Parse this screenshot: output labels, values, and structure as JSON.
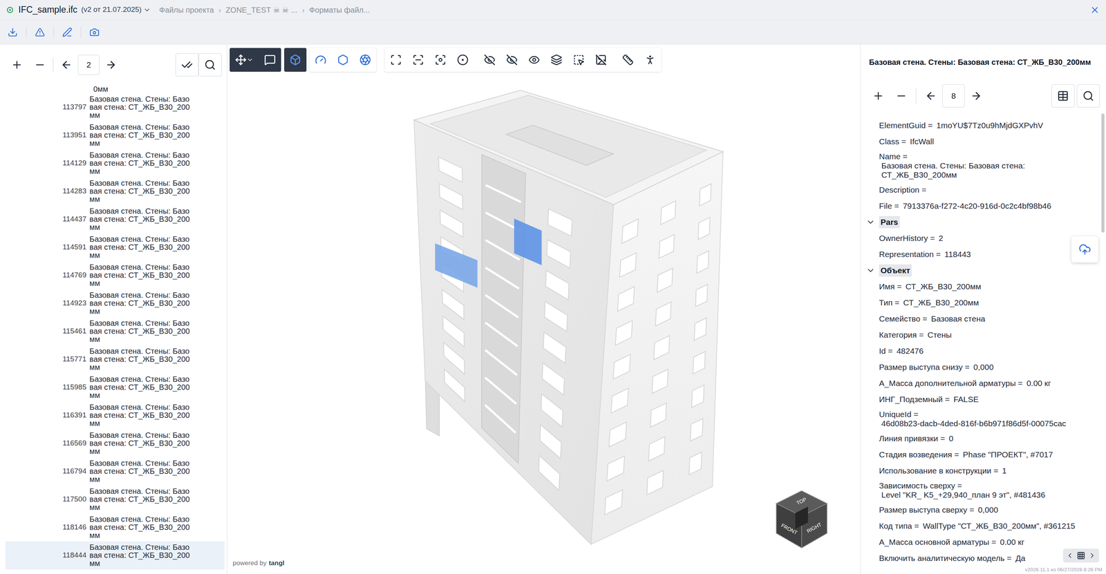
{
  "header": {
    "file": "IFC_sample.ifc",
    "version": "(v2 от 21.07.2025)",
    "breadcrumb": [
      "Файлы проекта",
      "ZONE_TEST ☠ ☠ ...",
      "Форматы файл..."
    ],
    "separator": "›"
  },
  "left_panel": {
    "page": "2",
    "clipped_top": "0мм",
    "items": [
      {
        "id": "113797",
        "name": "Базовая стена. Стены: Базовая стена: СТ_ЖБ_В30_200мм",
        "selected": false
      },
      {
        "id": "113951",
        "name": "Базовая стена. Стены: Базовая стена: СТ_ЖБ_В30_200мм",
        "selected": false
      },
      {
        "id": "114129",
        "name": "Базовая стена. Стены: Базовая стена: СТ_ЖБ_В30_200мм",
        "selected": false
      },
      {
        "id": "114283",
        "name": "Базовая стена. Стены: Базовая стена: СТ_ЖБ_В30_200мм",
        "selected": false
      },
      {
        "id": "114437",
        "name": "Базовая стена. Стены: Базовая стена: СТ_ЖБ_В30_200мм",
        "selected": false
      },
      {
        "id": "114591",
        "name": "Базовая стена. Стены: Базовая стена: СТ_ЖБ_В30_200мм",
        "selected": false
      },
      {
        "id": "114769",
        "name": "Базовая стена. Стены: Базовая стена: СТ_ЖБ_В30_200мм",
        "selected": false
      },
      {
        "id": "114923",
        "name": "Базовая стена. Стены: Базовая стена: СТ_ЖБ_В30_200мм",
        "selected": false
      },
      {
        "id": "115461",
        "name": "Базовая стена. Стены: Базовая стена: СТ_ЖБ_В30_200мм",
        "selected": false
      },
      {
        "id": "115771",
        "name": "Базовая стена. Стены: Базовая стена: СТ_ЖБ_В30_200мм",
        "selected": false
      },
      {
        "id": "115985",
        "name": "Базовая стена. Стены: Базовая стена: СТ_ЖБ_В30_200мм",
        "selected": false
      },
      {
        "id": "116391",
        "name": "Базовая стена. Стены: Базовая стена: СТ_ЖБ_В30_200мм",
        "selected": false
      },
      {
        "id": "116569",
        "name": "Базовая стена. Стены: Базовая стена: СТ_ЖБ_В30_200мм",
        "selected": false
      },
      {
        "id": "116794",
        "name": "Базовая стена. Стены: Базовая стена: СТ_ЖБ_В30_200мм",
        "selected": false
      },
      {
        "id": "117500",
        "name": "Базовая стена. Стены: Базовая стена: СТ_ЖБ_В30_200мм",
        "selected": false
      },
      {
        "id": "118146",
        "name": "Базовая стена. Стены: Базовая стена: СТ_ЖБ_В30_200мм",
        "selected": false
      },
      {
        "id": "118444",
        "name": "Базовая стена. Стены: Базовая стена: СТ_ЖБ_В30_200мм",
        "selected": true
      }
    ]
  },
  "viewer": {
    "powered_by": "powered by",
    "brand": "tangl",
    "cube": {
      "top": "TOP",
      "front": "FRONT",
      "right": "RIGHT"
    }
  },
  "properties_panel": {
    "title": "Базовая стена. Стены: Базовая стена: СТ_ЖБ_В30_200мм",
    "page": "8",
    "properties": [
      {
        "key": "ElementGuid =",
        "value": "1moYU$7Tz0u9hMjdGXPvhV",
        "wrap": false
      },
      {
        "key": "Class =",
        "value": "IfcWall",
        "wrap": false
      },
      {
        "key": "Name =",
        "value": "Базовая стена. Стены: Базовая стена: СТ_ЖБ_В30_200мм",
        "wrap": true
      },
      {
        "key": "Description =",
        "value": "",
        "wrap": false
      },
      {
        "key": "File =",
        "value": "7913376a-f272-4c20-916d-0c2c4bf98b46",
        "wrap": false
      }
    ],
    "sections": [
      {
        "label": "Pars",
        "expanded": true,
        "properties": [
          {
            "key": "OwnerHistory =",
            "value": "2",
            "wrap": false
          },
          {
            "key": "Representation =",
            "value": "118443",
            "wrap": false
          }
        ]
      },
      {
        "label": "Объект",
        "expanded": true,
        "properties": [
          {
            "key": "Имя =",
            "value": "СТ_ЖБ_В30_200мм",
            "wrap": false
          },
          {
            "key": "Тип =",
            "value": "СТ_ЖБ_В30_200мм",
            "wrap": false
          },
          {
            "key": "Семейство =",
            "value": "Базовая стена",
            "wrap": false
          },
          {
            "key": "Категория =",
            "value": "Стены",
            "wrap": false
          },
          {
            "key": "Id =",
            "value": "482476",
            "wrap": false
          },
          {
            "key": "Размер выступа снизу =",
            "value": "0,000",
            "wrap": false
          },
          {
            "key": "А_Масса дополнительной арматуры =",
            "value": "0.00 кг",
            "wrap": false
          },
          {
            "key": "ИНГ_Подземный =",
            "value": "FALSE",
            "wrap": false
          },
          {
            "key": "UniqueId =",
            "value": "46d08b23-dacb-4ded-816f-b6b971f86d5f-00075cac",
            "wrap": true
          },
          {
            "key": "Линия привязки =",
            "value": "0",
            "wrap": false
          },
          {
            "key": "Стадия возведения =",
            "value": "Phase \"ПРОЕКТ\", #7017",
            "wrap": false
          },
          {
            "key": "Использование в конструкции =",
            "value": "1",
            "wrap": false
          },
          {
            "key": "Зависимость сверху =",
            "value": "Level \"KR_ K5_+29,940_план 9 эт\", #481436",
            "wrap": true
          },
          {
            "key": "Размер выступа сверху =",
            "value": "0,000",
            "wrap": false
          },
          {
            "key": "Код типа =",
            "value": "WallType \"СТ_ЖБ_В30_200мм\", #361215",
            "wrap": false
          },
          {
            "key": "А_Масса основной арматуры =",
            "value": "0.00 кг",
            "wrap": false
          },
          {
            "key": "Включить аналитическую модель =",
            "value": "Да",
            "wrap": false
          }
        ]
      }
    ]
  },
  "footer": {
    "version": "v2026.11.1 из 06/27/2026 8:26 PM"
  }
}
